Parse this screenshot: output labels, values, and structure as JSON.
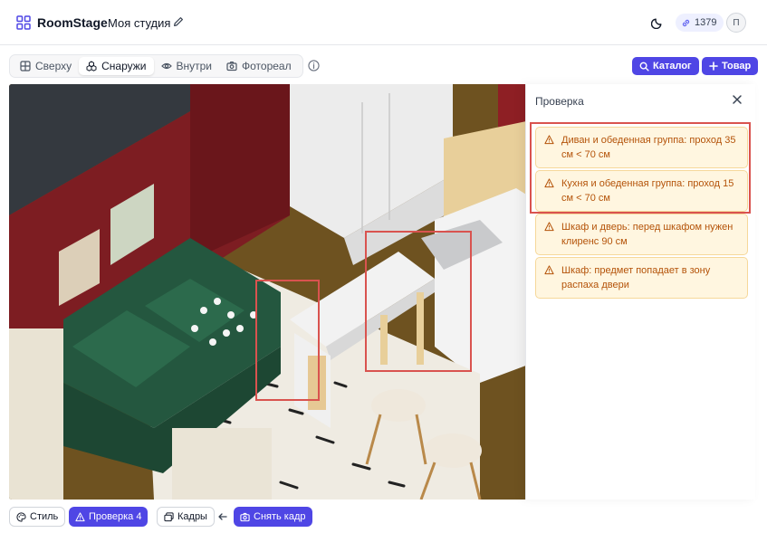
{
  "header": {
    "brand": "RoomStage",
    "project_name": "Моя студия",
    "credits": "1379",
    "avatar_initial": "П"
  },
  "view_tabs": [
    {
      "label": "Сверху",
      "icon": "grid-icon",
      "active": false
    },
    {
      "label": "Снаружи",
      "icon": "cubes-icon",
      "active": true
    },
    {
      "label": "Внутри",
      "icon": "eye-icon",
      "active": false
    },
    {
      "label": "Фотореал",
      "icon": "camera-icon",
      "active": false
    }
  ],
  "toolbar": {
    "catalog_label": "Каталог",
    "add_product_label": "Товар"
  },
  "check_panel": {
    "title": "Проверка",
    "warnings": [
      "Диван и обеденная группа: проход 35 см < 70 см",
      "Кухня и обеденная группа: проход 15 см < 70 см",
      "Шкаф и дверь: перед шкафом нужен клиренс 90 см",
      "Шкаф: предмет попадает в зону распаха двери"
    ]
  },
  "bottom": {
    "style_label": "Стиль",
    "check_label": "Проверка 4",
    "frames_label": "Кадры",
    "capture_label": "Снять кадр"
  },
  "colors": {
    "accent": "#4f46e5",
    "warning_bg": "#fff6e0",
    "warning_text": "#b45309",
    "highlight": "#d9534f"
  }
}
